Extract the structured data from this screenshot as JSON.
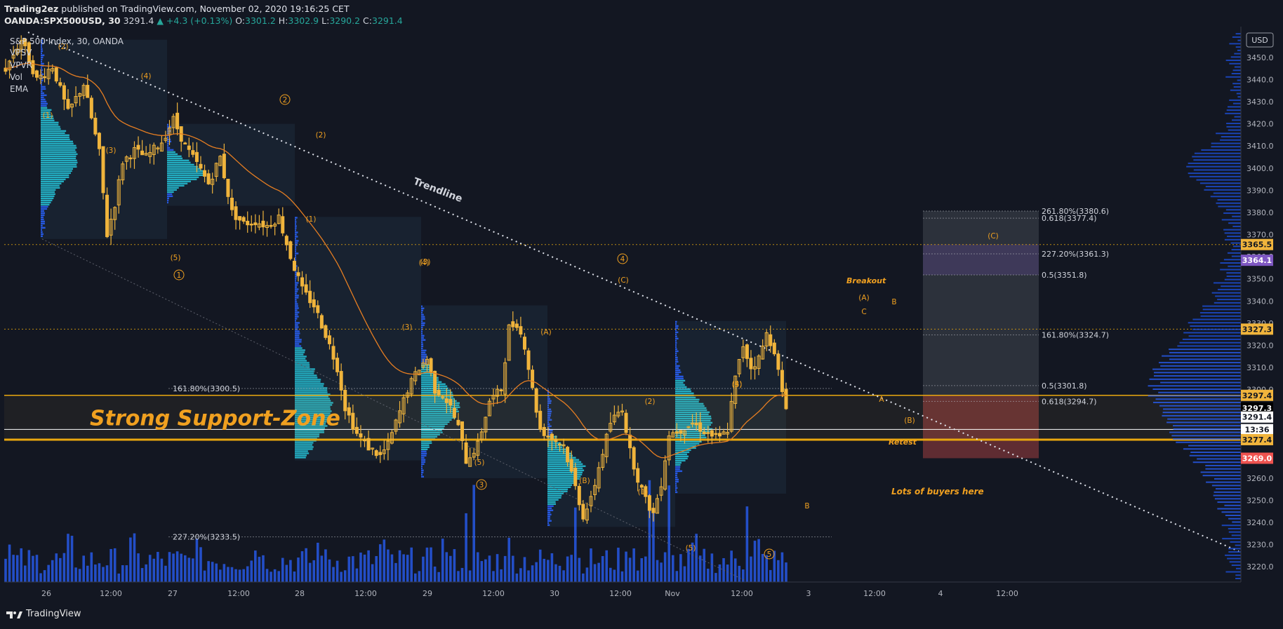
{
  "header": {
    "author": "Trading2ez",
    "published": " published on TradingView.com, November 02, 2020 19:16:25 CET",
    "symbol": "OANDA:SPX500USD, 30",
    "last": "3291.4",
    "change": "▲ +4.3 (+0.13%)",
    "o_label": "O:",
    "o_val": "3301.2",
    "h_label": "H:",
    "h_val": "3302.9",
    "l_label": "L:",
    "l_val": "3290.2",
    "c_label": "C:",
    "c_val": "3291.4"
  },
  "legend": {
    "title": "S&P 500 Index, 30, OANDA",
    "indicators": [
      "VPSV",
      "VPVR",
      "Vol",
      "EMA"
    ]
  },
  "footer": {
    "brand": "TradingView"
  },
  "colors": {
    "background": "#131722",
    "candle": "#f0b43c",
    "volume": "#2962ff",
    "profile": "#26c6da",
    "support": "#e8a70e",
    "ema": "#e67e22",
    "annotation": "#f0a020"
  },
  "chart_data": {
    "type": "candlestick",
    "symbol": "S&P 500 Index, 30, OANDA",
    "currency": "USD",
    "ylim": [
      3215,
      3462
    ],
    "y_ticks": [
      3220,
      3230,
      3240,
      3250,
      3260,
      3270,
      3280,
      3290,
      3300,
      3310,
      3320,
      3330,
      3340,
      3350,
      3360,
      3370,
      3380,
      3390,
      3400,
      3410,
      3420,
      3430,
      3440,
      3450
    ],
    "x_ticks": [
      "26",
      "12:00",
      "27",
      "12:00",
      "28",
      "12:00",
      "29",
      "12:00",
      "30",
      "12:00",
      "Nov",
      "12:00",
      "3",
      "12:00",
      "4",
      "12:00"
    ],
    "price_path": [
      [
        0,
        3445
      ],
      [
        4,
        3458
      ],
      [
        8,
        3440
      ],
      [
        12,
        3446
      ],
      [
        16,
        3425
      ],
      [
        20,
        3438
      ],
      [
        24,
        3407
      ],
      [
        26,
        3370
      ],
      [
        28,
        3384
      ],
      [
        30,
        3403
      ],
      [
        33,
        3408
      ],
      [
        36,
        3405
      ],
      [
        40,
        3412
      ],
      [
        43,
        3422
      ],
      [
        46,
        3410
      ],
      [
        49,
        3402
      ],
      [
        52,
        3393
      ],
      [
        55,
        3405
      ],
      [
        58,
        3380
      ],
      [
        61,
        3375
      ],
      [
        64,
        3376
      ],
      [
        67,
        3374
      ],
      [
        70,
        3378
      ],
      [
        73,
        3360
      ],
      [
        76,
        3345
      ],
      [
        79,
        3338
      ],
      [
        82,
        3325
      ],
      [
        85,
        3310
      ],
      [
        87,
        3292
      ],
      [
        90,
        3280
      ],
      [
        93,
        3274
      ],
      [
        96,
        3270
      ],
      [
        98,
        3275
      ],
      [
        100,
        3285
      ],
      [
        103,
        3300
      ],
      [
        106,
        3310
      ],
      [
        108,
        3314
      ],
      [
        110,
        3300
      ],
      [
        112,
        3298
      ],
      [
        114,
        3292
      ],
      [
        116,
        3283
      ],
      [
        118,
        3268
      ],
      [
        121,
        3275
      ],
      [
        124,
        3295
      ],
      [
        127,
        3300
      ],
      [
        129,
        3328
      ],
      [
        131,
        3330
      ],
      [
        133,
        3320
      ],
      [
        135,
        3300
      ],
      [
        137,
        3282
      ],
      [
        140,
        3278
      ],
      [
        143,
        3275
      ],
      [
        146,
        3256
      ],
      [
        148,
        3243
      ],
      [
        150,
        3250
      ],
      [
        152,
        3265
      ],
      [
        155,
        3285
      ],
      [
        158,
        3292
      ],
      [
        160,
        3272
      ],
      [
        162,
        3260
      ],
      [
        164,
        3250
      ],
      [
        166,
        3244
      ],
      [
        168,
        3258
      ],
      [
        170,
        3280
      ],
      [
        173,
        3282
      ],
      [
        176,
        3285
      ],
      [
        180,
        3280
      ],
      [
        183,
        3278
      ],
      [
        185,
        3282
      ],
      [
        187,
        3305
      ],
      [
        189,
        3320
      ],
      [
        191,
        3310
      ],
      [
        193,
        3314
      ],
      [
        195,
        3325
      ],
      [
        197,
        3318
      ],
      [
        199,
        3298
      ],
      [
        200,
        3291.4
      ]
    ],
    "volume_profile_note": "session volume profiles on each day plus visible-range profile at right edge",
    "price_labels": [
      {
        "value": "3365.5",
        "color": "#f0b43c",
        "text_color": "#131722"
      },
      {
        "value": "3364.1",
        "color": "#7e57c2",
        "text_color": "#ffffff"
      },
      {
        "value": "3327.3",
        "color": "#f0b43c",
        "text_color": "#131722"
      },
      {
        "value": "3297.4",
        "color": "#f0b43c",
        "text_color": "#131722"
      },
      {
        "value": "3297.3",
        "color": "#000000",
        "text_color": "#ffffff"
      },
      {
        "value": "3291.4",
        "color": "#ffffff",
        "text_color": "#131722"
      },
      {
        "value": "13:36",
        "color": "#ffffff",
        "text_color": "#131722"
      },
      {
        "value": "3277.4",
        "color": "#f0b43c",
        "text_color": "#131722"
      },
      {
        "value": "3269.0",
        "color": "#ef5350",
        "text_color": "#ffffff"
      }
    ],
    "fib_labels": [
      {
        "text": "261.80%(3380.6)",
        "value": 3380.6
      },
      {
        "text": "0.618(3377.4)",
        "value": 3377.4
      },
      {
        "text": "227.20%(3361.3)",
        "value": 3361.3
      },
      {
        "text": "0.5(3351.8)",
        "value": 3351.8
      },
      {
        "text": "161.80%(3324.7)",
        "value": 3324.7
      },
      {
        "text": "0.5(3301.8)",
        "value": 3301.8
      },
      {
        "text": "0.618(3294.7)",
        "value": 3294.7
      },
      {
        "text": "161.80%(3300.5)",
        "value": 3300.5
      },
      {
        "text": "227.20%(3233.5)",
        "value": 3233.5
      }
    ],
    "annotations": {
      "support_zone": "Strong Support-Zone",
      "trendline": "Trendline",
      "breakout": "Breakout",
      "retest": "Retest",
      "buyers": "Lots of buyers here",
      "waves": [
        "(2)",
        "(4)",
        "(1)",
        "(3)",
        "(5)",
        "1",
        "2",
        "(2)",
        "(1)",
        "(3)",
        "(4)",
        "(3)",
        "(5)",
        "3",
        "(A)",
        "(B)",
        "(C)",
        "4",
        "(2)",
        "(1)",
        "(4)",
        "(3)",
        "(5)",
        "5",
        "A",
        "B",
        "(A)",
        "C",
        "B",
        "A",
        "(B)",
        "(C)"
      ]
    }
  }
}
